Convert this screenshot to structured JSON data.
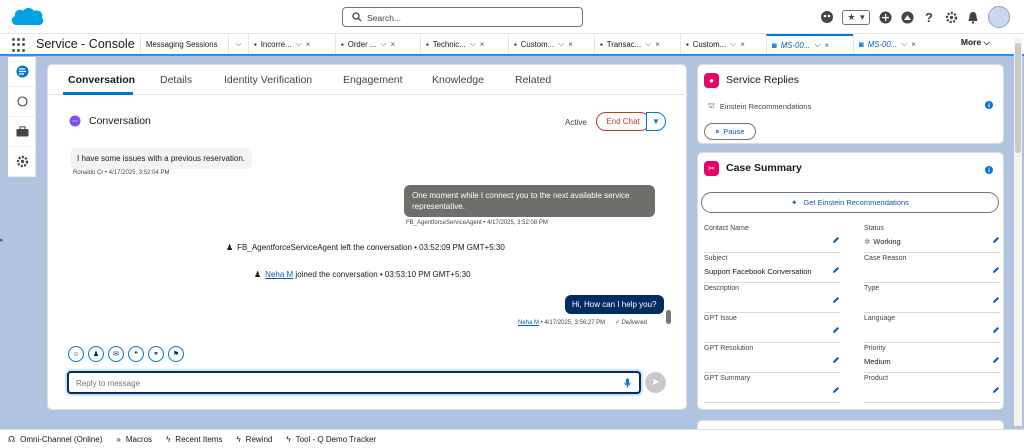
{
  "header": {
    "search_placeholder": "Search...",
    "fav_star": "★",
    "fav_caret": "▾"
  },
  "nav": {
    "app_name": "Service - Console",
    "first_tab": "Messaging Sessions",
    "tabs": [
      {
        "label": "Incorre..."
      },
      {
        "label": "Order ..."
      },
      {
        "label": "Technic..."
      },
      {
        "label": "Custom..."
      },
      {
        "label": "Transac..."
      },
      {
        "label": "Custom..."
      },
      {
        "label": "MS-00..."
      },
      {
        "label": "MS-00..."
      }
    ],
    "more_label": "More"
  },
  "record_tabs": [
    "Conversation",
    "Details",
    "Identity Verification",
    "Engagement",
    "Knowledge",
    "Related"
  ],
  "conversation": {
    "title": "Conversation",
    "status": "Active",
    "end_chat": "End Chat",
    "messages": {
      "customer_text": "I have some issues with a previous reservation.",
      "customer_meta": "Ronaldo Cr • 4/17/2025, 3:52:04 PM",
      "bot_text": "One moment while I connect you to the next available service representative.",
      "bot_meta": "FB_AgentforceServiceAgent • 4/17/2025, 3:52:08 PM",
      "event1": "FB_AgentforceServiceAgent left the conversation • 03:52:09 PM GMT+5:30",
      "event2_who": "Neha M",
      "event2_rest": " joined the conversation • 03:53:10 PM GMT+5:30",
      "agent_text": "Hi, How can I help you?",
      "agent_name": "Neha M",
      "agent_meta": " • 4/17/2025, 3:56:27 PM",
      "delivered": "Delivered"
    },
    "reply_placeholder": "Reply to message"
  },
  "service_replies": {
    "title": "Service Replies",
    "sub": "Einstein Recommendations",
    "pause": "Pause"
  },
  "case_summary": {
    "title": "Case Summary",
    "einstein_btn": "Get Einstein Recommendations",
    "fields_left": [
      {
        "label": "Contact Name",
        "value": ""
      },
      {
        "label": "Subject",
        "value": "Support Facebook Conversation"
      },
      {
        "label": "Description",
        "value": ""
      },
      {
        "label": "GPT Issue",
        "value": ""
      },
      {
        "label": "GPT Resolution",
        "value": ""
      },
      {
        "label": "GPT Summary",
        "value": ""
      }
    ],
    "fields_right": [
      {
        "label": "Status",
        "value": "Working"
      },
      {
        "label": "Case Reason",
        "value": ""
      },
      {
        "label": "Type",
        "value": ""
      },
      {
        "label": "Language",
        "value": ""
      },
      {
        "label": "Priority",
        "value": "Medium"
      },
      {
        "label": "Product",
        "value": ""
      }
    ]
  },
  "footer": {
    "omni": "Omni-Channel (Online)",
    "macros": "Macros",
    "recent": "Recent Items",
    "rewind": "Rewind",
    "tool": "Tool - Q Demo Tracker"
  },
  "colors": {
    "brand": "#0176d3",
    "end_chat": "#c23934",
    "agent_bubble": "#032d60",
    "bot_bubble": "#706e6b"
  }
}
